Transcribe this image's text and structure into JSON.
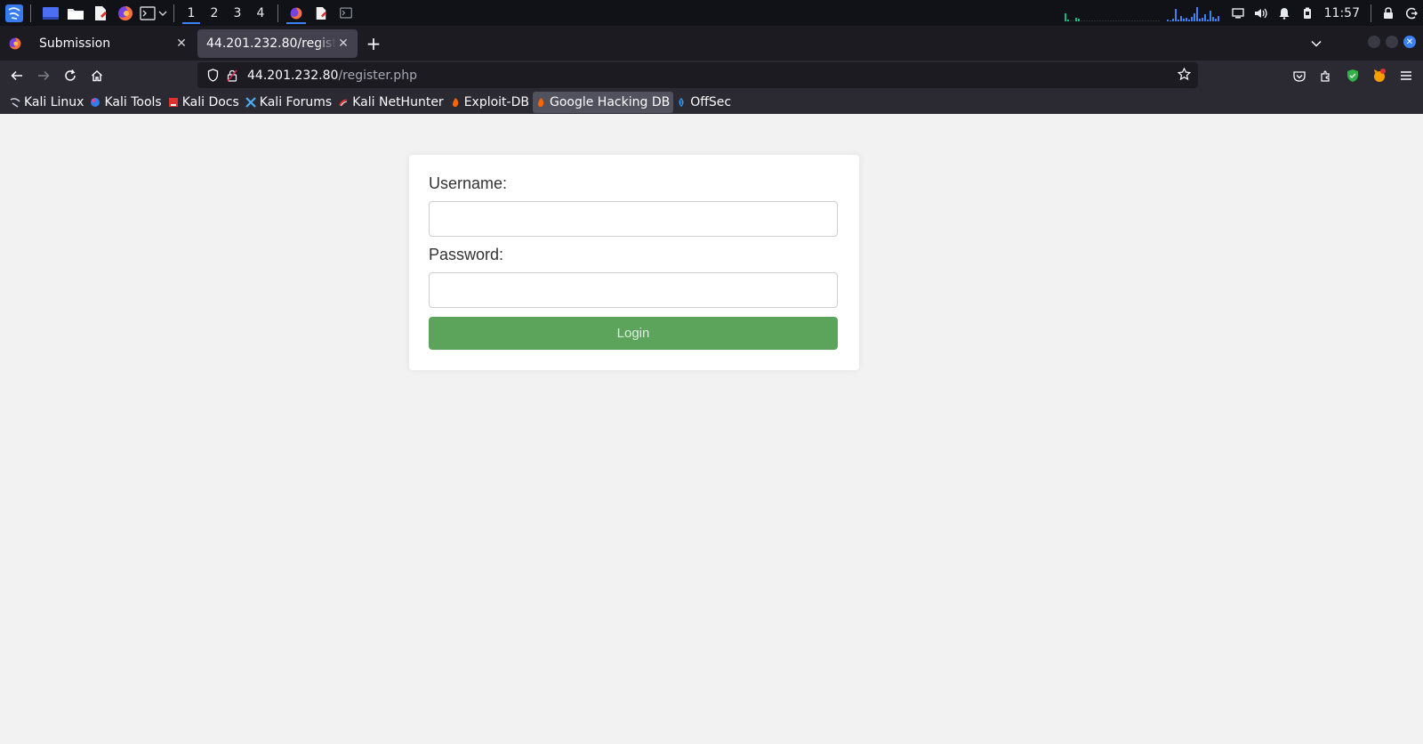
{
  "taskbar": {
    "workspaces": [
      "1",
      "2",
      "3",
      "4"
    ],
    "active_workspace": "1",
    "clock": "11:57",
    "accent_color": "#3b82f6"
  },
  "browser": {
    "tabs": [
      {
        "title": "Submission",
        "active": false
      },
      {
        "title": "44.201.232.80/register.p",
        "active": true
      }
    ],
    "url": {
      "host": "44.201.232.80",
      "path": "/register.php"
    },
    "bookmarks": [
      {
        "label": "Kali Linux",
        "icon": "kali-icon"
      },
      {
        "label": "Kali Tools",
        "icon": "kali-tools-icon"
      },
      {
        "label": "Kali Docs",
        "icon": "kali-docs-icon"
      },
      {
        "label": "Kali Forums",
        "icon": "kali-forums-icon"
      },
      {
        "label": "Kali NetHunter",
        "icon": "nethunter-icon"
      },
      {
        "label": "Exploit-DB",
        "icon": "exploit-db-icon"
      },
      {
        "label": "Google Hacking DB",
        "icon": "ghdb-icon"
      },
      {
        "label": "OffSec",
        "icon": "offsec-icon"
      }
    ]
  },
  "login_form": {
    "username_label": "Username:",
    "username_value": "",
    "password_label": "Password:",
    "password_value": "",
    "submit_label": "Login",
    "button_color": "#5ca45c"
  }
}
